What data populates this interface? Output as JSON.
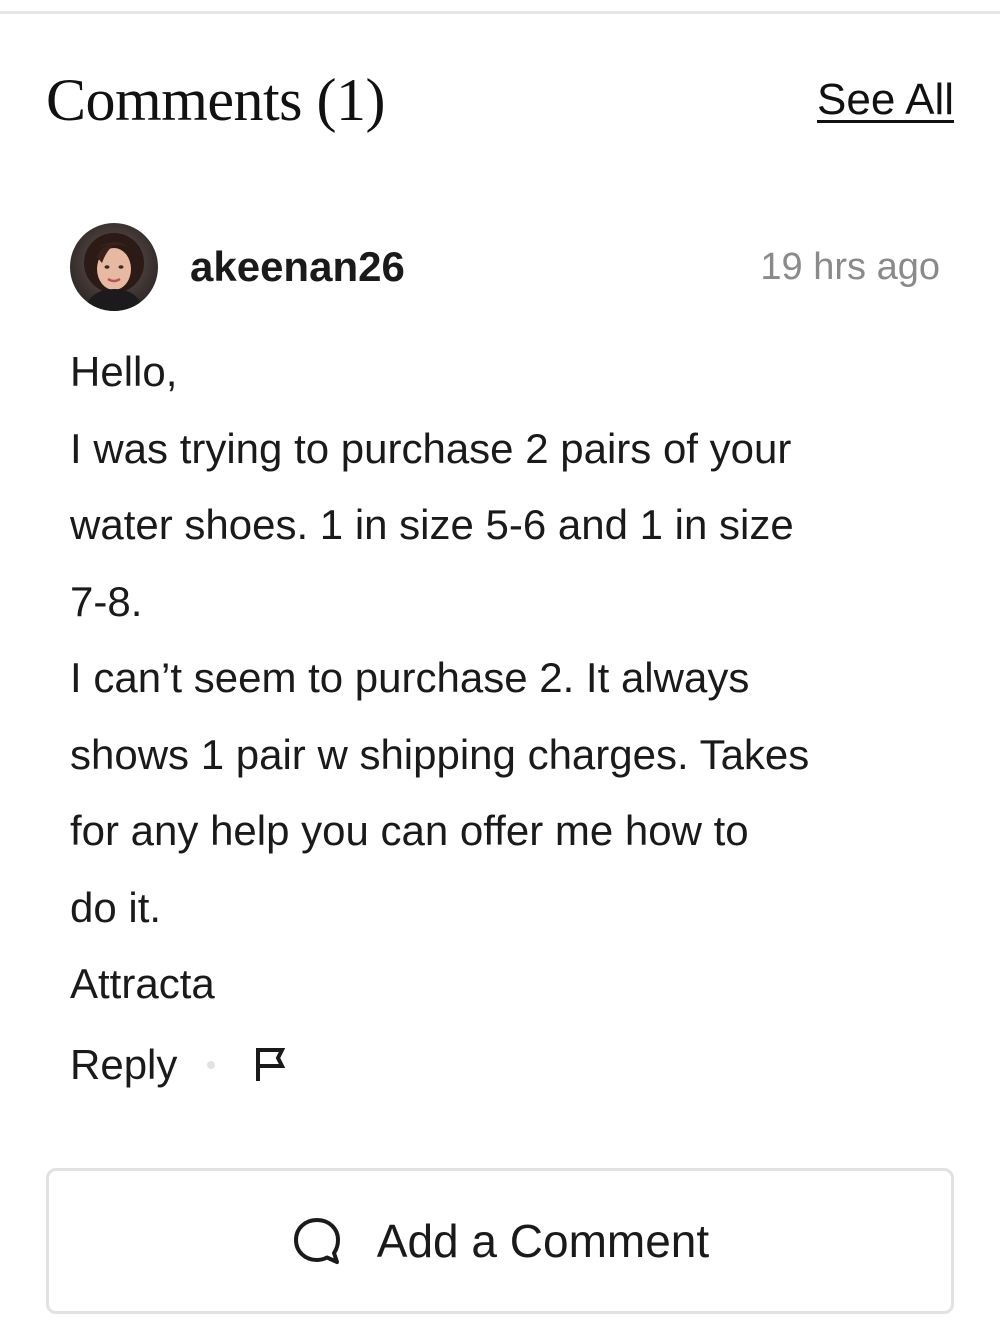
{
  "header": {
    "title": "Comments (1)",
    "see_all_label": "See All"
  },
  "comment": {
    "username": "akeenan26",
    "timestamp": "19 hrs ago",
    "avatar_icon": "user-avatar-photo",
    "lines": [
      "Hello,",
      "I was trying to purchase 2 pairs of your",
      "water shoes. 1 in size 5-6 and 1 in size",
      "7-8.",
      "I can’t seem to purchase 2. It always",
      "shows 1 pair w shipping charges. Takes",
      "for any help you can offer me how to",
      "do it.",
      "Attracta"
    ],
    "reply_label": "Reply",
    "flag_icon": "flag-icon"
  },
  "add_comment": {
    "label": "Add a Comment",
    "icon": "speech-bubble-icon"
  },
  "colors": {
    "text": "#1a1a1a",
    "muted": "#8a8a8a",
    "border": "#e2e2e2"
  }
}
